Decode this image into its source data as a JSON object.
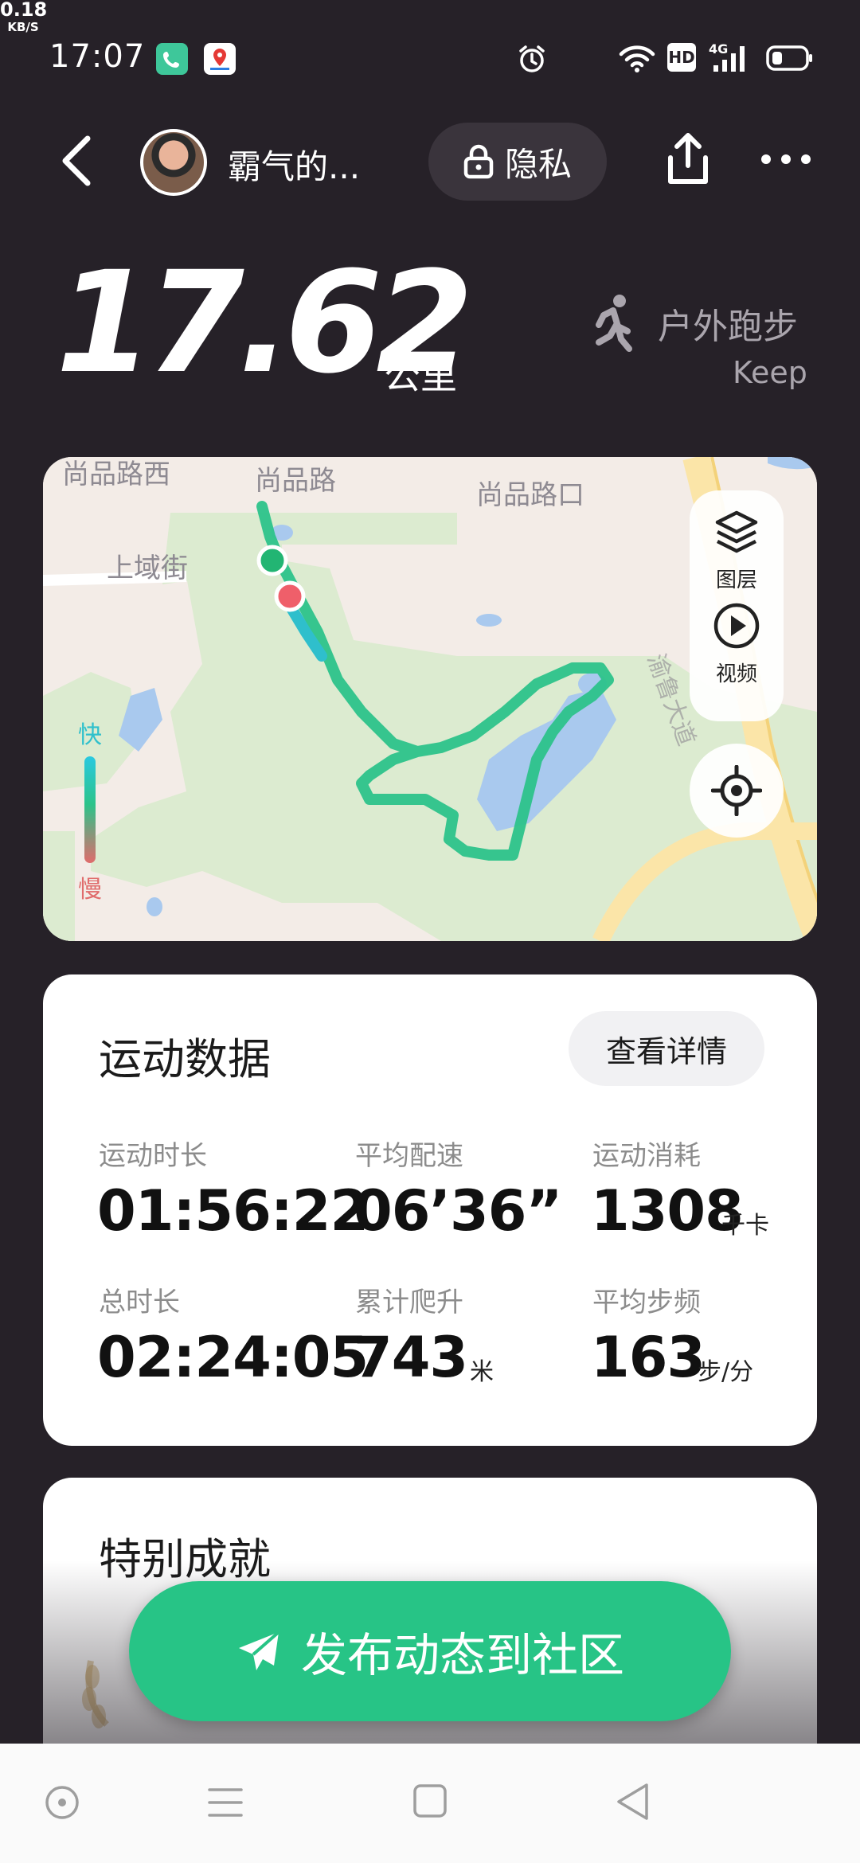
{
  "status_bar": {
    "time": "17:07",
    "net_speed_value": "0.18",
    "net_speed_unit": "KB/S",
    "hd_badge": "HD",
    "network_type": "4G",
    "icons": [
      "phone-app-icon",
      "maps-app-icon",
      "alarm-icon",
      "wifi-icon",
      "hd-icon",
      "signal-icon",
      "battery-icon"
    ]
  },
  "header": {
    "user_name": "霸气的...",
    "privacy_label": "隐私",
    "icons": [
      "back-icon",
      "lock-icon",
      "share-icon",
      "more-icon"
    ]
  },
  "summary": {
    "distance": "17.62",
    "distance_unit": "公里",
    "sport_type": "户外跑步",
    "brand": "Keep"
  },
  "map": {
    "labels": [
      "尚品路西",
      "尚品路",
      "尚品路口",
      "上域街",
      "渝鲁大道"
    ],
    "layers_label": "图层",
    "video_label": "视频",
    "legend_fast": "快",
    "legend_slow": "慢",
    "colors": {
      "route": "#2cc38a",
      "start": "#22b573",
      "end": "#ef5f6a"
    }
  },
  "stats": {
    "title": "运动数据",
    "detail_button": "查看详情",
    "items": [
      {
        "label": "运动时长",
        "value": "01:56:22",
        "unit": ""
      },
      {
        "label": "平均配速",
        "value": "06’36”",
        "unit": ""
      },
      {
        "label": "运动消耗",
        "value": "1308",
        "unit": "千卡"
      },
      {
        "label": "总时长",
        "value": "02:24:05",
        "unit": ""
      },
      {
        "label": "累计爬升",
        "value": "743",
        "unit": "米"
      },
      {
        "label": "平均步频",
        "value": "163",
        "unit": "步/分"
      }
    ]
  },
  "achievements": {
    "title": "特别成就"
  },
  "publish": {
    "label": "发布动态到社区",
    "color": "#27c486"
  },
  "nav_bar": {
    "icons": [
      "home-circle-icon",
      "menu-icon",
      "square-icon",
      "back-triangle-icon"
    ]
  }
}
